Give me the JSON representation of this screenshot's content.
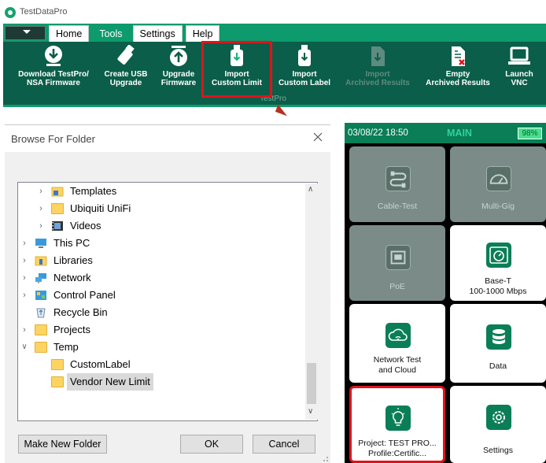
{
  "app": {
    "title": "TestDataPro"
  },
  "ribbon": {
    "tabs": [
      "Home",
      "Tools",
      "Settings",
      "Help"
    ],
    "active_tab": "Tools",
    "group_label": "TestPro",
    "tools": [
      {
        "line1": "Download TestPro/",
        "line2": "NSA Firmware",
        "icon": "download-icon",
        "enabled": true
      },
      {
        "line1": "Create USB",
        "line2": "Upgrade",
        "icon": "usb-stick-icon",
        "enabled": true
      },
      {
        "line1": "Upgrade",
        "line2": "Firmware",
        "icon": "upload-icon",
        "enabled": true
      },
      {
        "line1": "Import",
        "line2": "Custom Limit",
        "icon": "usb-import-icon",
        "enabled": true
      },
      {
        "line1": "Import",
        "line2": "Custom Label",
        "icon": "usb-import-icon",
        "enabled": true
      },
      {
        "line1": "Import",
        "line2": "Archived Results",
        "icon": "archive-import-icon",
        "enabled": false
      },
      {
        "line1": "Empty",
        "line2": "Archived Results",
        "icon": "archive-empty-icon",
        "enabled": true
      },
      {
        "line1": "Launch",
        "line2": "VNC",
        "icon": "laptop-icon",
        "enabled": true
      }
    ]
  },
  "dialog": {
    "title": "Browse For Folder",
    "tree": [
      {
        "label": "Templates",
        "icon": "templates-folder-icon",
        "expandable": true,
        "expanded": false,
        "selected": false
      },
      {
        "label": "Ubiquiti UniFi",
        "icon": "folder-icon",
        "expandable": true,
        "expanded": false,
        "selected": false
      },
      {
        "label": "Videos",
        "icon": "videos-folder-icon",
        "expandable": true,
        "expanded": false,
        "selected": false
      },
      {
        "label": "This PC",
        "icon": "computer-icon",
        "expandable": true,
        "expanded": false,
        "selected": false
      },
      {
        "label": "Libraries",
        "icon": "libraries-icon",
        "expandable": true,
        "expanded": false,
        "selected": false
      },
      {
        "label": "Network",
        "icon": "network-icon",
        "expandable": true,
        "expanded": false,
        "selected": false
      },
      {
        "label": "Control Panel",
        "icon": "control-panel-icon",
        "expandable": true,
        "expanded": false,
        "selected": false
      },
      {
        "label": "Recycle Bin",
        "icon": "recycle-bin-icon",
        "expandable": false,
        "expanded": false,
        "selected": false
      },
      {
        "label": "Projects",
        "icon": "folder-icon",
        "expandable": true,
        "expanded": false,
        "selected": false
      },
      {
        "label": "Temp",
        "icon": "folder-icon",
        "expandable": true,
        "expanded": true,
        "selected": false
      },
      {
        "label": "CustomLabel",
        "icon": "folder-icon",
        "expandable": false,
        "expanded": false,
        "selected": false
      },
      {
        "label": "Vendor New Limit",
        "icon": "folder-icon",
        "expandable": false,
        "expanded": false,
        "selected": true
      }
    ],
    "buttons": {
      "make_new_folder": "Make New Folder",
      "ok": "OK",
      "cancel": "Cancel"
    }
  },
  "device": {
    "time": "03/08/22 18:50",
    "screen": "MAIN",
    "battery": "98%",
    "tiles": [
      {
        "line1": "Cable-Test",
        "line2": "",
        "icon": "cable-test-icon",
        "enabled": false,
        "highlighted": false
      },
      {
        "line1": "Multi-Gig",
        "line2": "",
        "icon": "gauge-icon",
        "enabled": false,
        "highlighted": false
      },
      {
        "line1": "PoE",
        "line2": "",
        "icon": "ethernet-port-icon",
        "enabled": false,
        "highlighted": false
      },
      {
        "line1": "Base-T",
        "line2": "100-1000 Mbps",
        "icon": "speedometer-icon",
        "enabled": true,
        "highlighted": false
      },
      {
        "line1": "Network Test",
        "line2": "and Cloud",
        "icon": "cloud-wifi-icon",
        "enabled": true,
        "highlighted": false
      },
      {
        "line1": "Data",
        "line2": "",
        "icon": "database-icon",
        "enabled": true,
        "highlighted": false
      },
      {
        "line1": "Project: TEST PRO...",
        "line2": "Profile:Certific...",
        "icon": "lightbulb-icon",
        "enabled": true,
        "highlighted": true
      },
      {
        "line1": "Settings",
        "line2": "",
        "icon": "gear-icon",
        "enabled": true,
        "highlighted": false
      }
    ]
  },
  "colors": {
    "ribbon_green": "#0d9a6c",
    "ribbon_dark": "#0b5e49",
    "highlight_red": "#e0131b",
    "device_green": "#0a7e57"
  }
}
